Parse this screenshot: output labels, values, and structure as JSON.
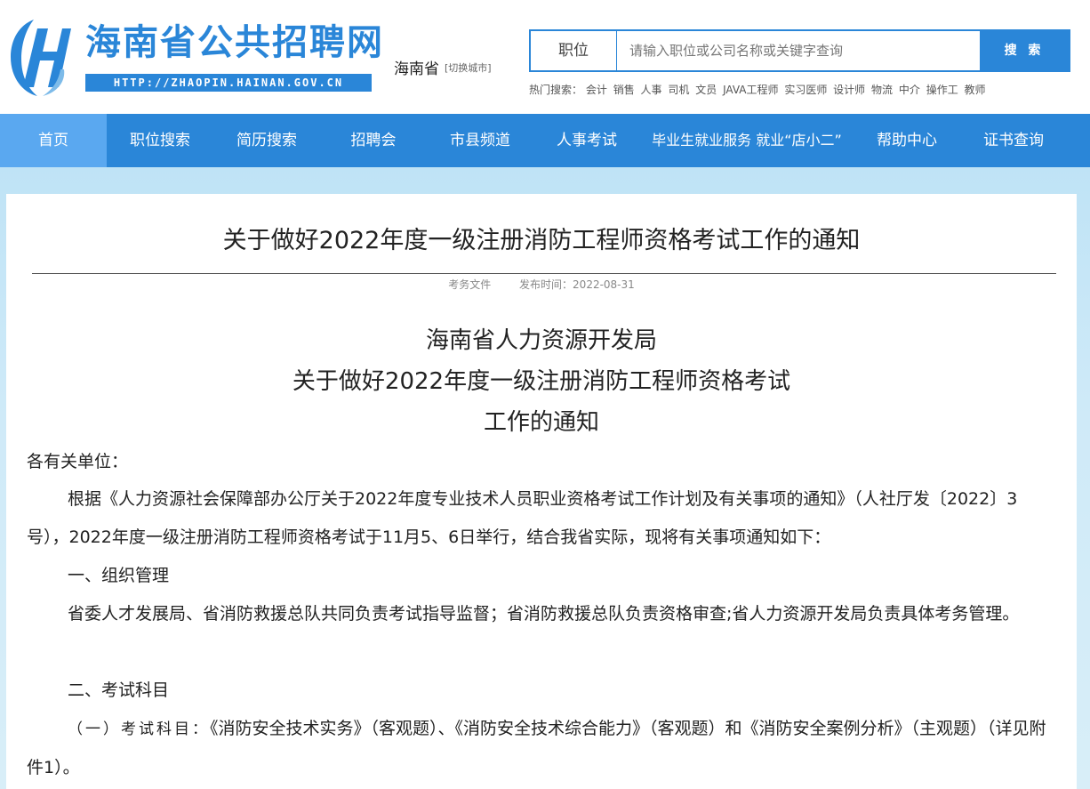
{
  "site": {
    "name": "海南省公共招聘网",
    "url": "HTTP://ZHAOPIN.HAINAN.GOV.CN",
    "city": "海南省",
    "city_switch": "[切换城市]"
  },
  "search": {
    "category": "职位",
    "placeholder": "请输入职位或公司名称或关键字查询",
    "button": "搜 索",
    "hot_label": "热门搜索：",
    "hot_keywords": [
      "会计",
      "销售",
      "人事",
      "司机",
      "文员",
      "JAVA工程师",
      "实习医师",
      "设计师",
      "物流",
      "中介",
      "操作工",
      "教师"
    ]
  },
  "nav": [
    "首页",
    "职位搜索",
    "简历搜索",
    "招聘会",
    "市县频道",
    "人事考试",
    "毕业生就业服务  就业“店小二”",
    "帮助中心",
    "证书查询"
  ],
  "article": {
    "title": "关于做好2022年度一级注册消防工程师资格考试工作的通知",
    "category": "考务文件",
    "date": "发布时间：2022-08-31",
    "heading_lines": [
      "海南省人力资源开发局",
      "关于做好2022年度一级注册消防工程师资格考试",
      "工作的通知"
    ],
    "salutation": "各有关单位：",
    "para1": "根据《人力资源社会保障部办公厅关于2022年度专业技术人员职业资格考试工作计划及有关事项的通知》（人社厅发〔2022〕3号），2022年度一级注册消防工程师资格考试于11月5、6日举行，结合我省实际，现将有关事项通知如下：",
    "section1": "一、组织管理",
    "para2": "省委人才发展局、省消防救援总队共同负责考试指导监督；省消防救援总队负责资格审查;省人力资源开发局负责具体考务管理。",
    "section2": "二、考试科目",
    "sub1_label": "（一）考试科目：",
    "sub1_text": "《消防安全技术实务》（客观题）、《消防安全技术综合能力》（客观题）和《消防安全案例分析》（主观题）（详见附件1）。"
  },
  "colors": {
    "brand": "#2a86d8",
    "nav_active": "#5aa8f0"
  }
}
